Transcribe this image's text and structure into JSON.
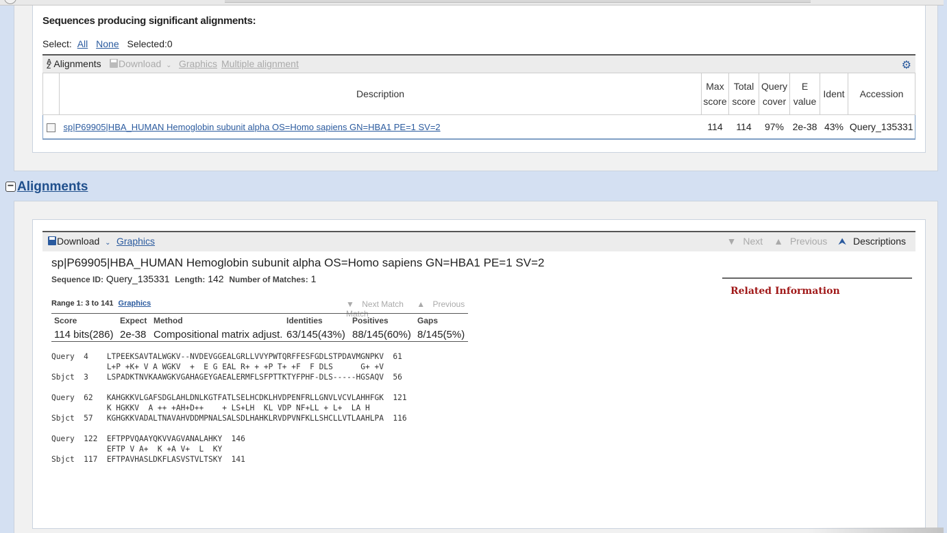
{
  "summary": {
    "title": "Sequences producing significant alignments:",
    "select_label": "Select:",
    "select_all": "All",
    "select_none": "None",
    "selected_text": "Selected:0",
    "toolbar": {
      "sort_icon": "sort-icon",
      "alignments": "Alignments",
      "download": "Download",
      "graphics": "Graphics",
      "multiple_alignment": "Multiple alignment",
      "gear_icon": "gear-icon"
    },
    "columns": {
      "description": "Description",
      "max_score": [
        "Max",
        "score"
      ],
      "total_score": [
        "Total",
        "score"
      ],
      "query_cover": [
        "Query",
        "cover"
      ],
      "e_value": [
        "E",
        "value"
      ],
      "ident": "Ident",
      "accession": "Accession"
    },
    "rows": [
      {
        "description": "sp|P69905|HBA_HUMAN Hemoglobin subunit alpha OS=Homo sapiens GN=HBA1 PE=1 SV=2",
        "max_score": "114",
        "total_score": "114",
        "query_cover": "97%",
        "e_value": "2e-38",
        "ident": "43%",
        "accession": "Query_135331"
      }
    ]
  },
  "alignments": {
    "header": "Alignments",
    "toolbar": {
      "download": "Download",
      "graphics": "Graphics",
      "next": "Next",
      "previous": "Previous",
      "descriptions": "Descriptions"
    },
    "hit_title": "sp|P69905|HBA_HUMAN Hemoglobin subunit alpha OS=Homo sapiens GN=HBA1 PE=1 SV=2",
    "seq_id_label": "Sequence ID:",
    "seq_id": "Query_135331",
    "length_label": "Length:",
    "length": "142",
    "matches_label": "Number of Matches:",
    "matches": "1",
    "related_info": "Related Information",
    "range": {
      "label": "Range 1: 3 to 141",
      "graphics": "Graphics",
      "next_match": "Next Match",
      "previous_match": "Previous Match"
    },
    "stats": {
      "score_h": "Score",
      "expect_h": "Expect",
      "method_h": "Method",
      "identities_h": "Identities",
      "positives_h": "Positives",
      "gaps_h": "Gaps",
      "score": "114 bits(286)",
      "expect": "2e-38",
      "method": "Compositional matrix adjust.",
      "identities": "63/145(43%)",
      "positives": "88/145(60%)",
      "gaps": "8/145(5%)"
    },
    "alignment_text": "Query  4    LTPEEKSAVTALWGKV--NVDEVGGEALGRLLVVYPWTQRFFESFGDLSTPDAVMGNPKV  61\n            L+P +K+ V A WGKV  +  E G EAL R+ + +P T+ +F  F DLS      G+ +V\nSbjct  3    LSPADKTNVKAAWGKVGAHAGEYGAEALERMFLSFPTTKTYFPHF-DLS-----HGSAQV  56\n\nQuery  62   KAHGKKVLGAFSDGLAHLDNLKGTFATLSELHCDKLHVDPENFRLLGNVLVCVLAHHFGK  121\n            K HGKKV  A ++ +AH+D++    + LS+LH  KL VDP NF+LL + L+  LA H\nSbjct  57   KGHGKKVADALTNAVAHVDDMPNALSALSDLHAHKLRVDPVNFKLLSHCLLVTLAAHLPA  116\n\nQuery  122  EFTPPVQAAYQKVVAGVANALAHKY  146\n            EFTP V A+  K +A V+  L  KY\nSbjct  117  EFTPAVHASLDKFLASVSTVLTSKY  141"
  }
}
